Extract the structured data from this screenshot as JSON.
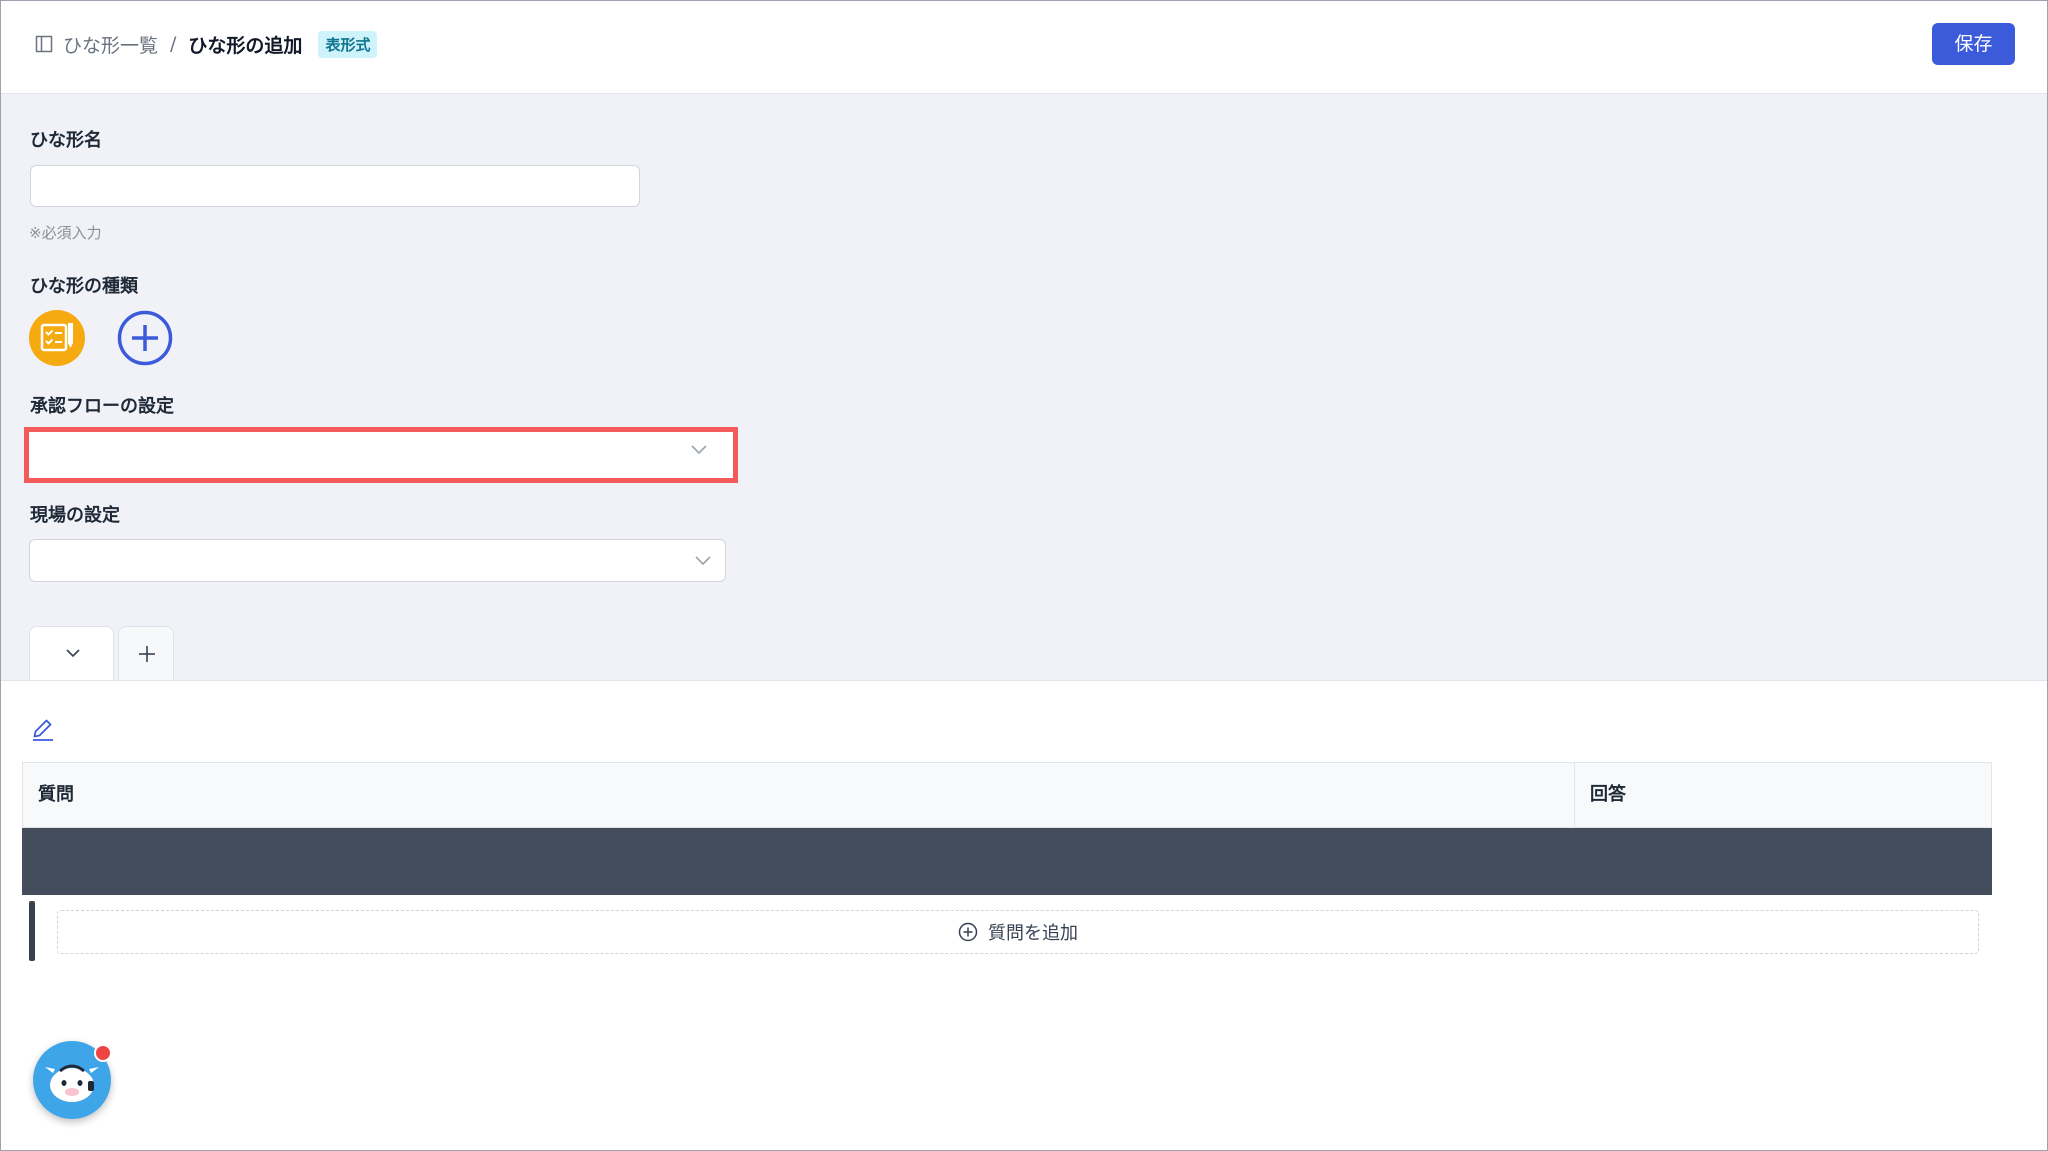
{
  "header": {
    "breadcrumb_root": "ひな形一覧",
    "breadcrumb_separator": "/",
    "breadcrumb_current": "ひな形の追加",
    "format_badge": "表形式",
    "save_label": "保存"
  },
  "form": {
    "template_name_label": "ひな形名",
    "template_name_value": "",
    "required_hint": "※必須入力",
    "template_type_label": "ひな形の種類",
    "approval_flow_label": "承認フローの設定",
    "approval_flow_value": "",
    "site_label": "現場の設定",
    "site_value": ""
  },
  "tabs": {
    "tab1_icon": "chevron-down-icon",
    "add_tab_icon": "plus-icon"
  },
  "table": {
    "columns": [
      "質問",
      "回答"
    ],
    "add_question_label": "質問を追加"
  },
  "colors": {
    "primary": "#3b5bdb",
    "highlight_border": "#f15b5b",
    "type_icon": "#f5ab0f",
    "dark_row": "#434d5b",
    "chat_widget": "#3ea6e8"
  }
}
